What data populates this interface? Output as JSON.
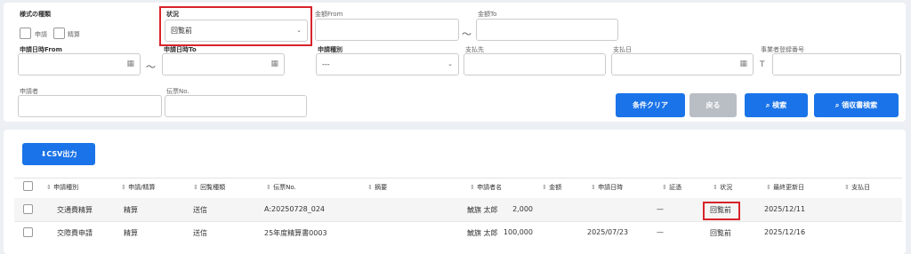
{
  "filter": {
    "form_type_label": "様式の種類",
    "checkbox_application": "申請",
    "checkbox_settlement": "精算",
    "status_label": "状況",
    "status_value": "回覧前",
    "amount_from_label": "金額From",
    "amount_to_label": "金額To",
    "tilde": "～",
    "date_from_label": "申請日時From",
    "date_to_label": "申請日時To",
    "app_type_label": "申請種別",
    "app_type_value": "---",
    "payee_label": "支払先",
    "pay_date_label": "支払日",
    "reg_no_label": "事業者登録番号",
    "reg_no_prefix": "T",
    "applicant_label": "申請者",
    "voucher_label": "伝票No.",
    "clear_button": "条件クリア",
    "back_button": "戻る",
    "search_button": "検索",
    "receipt_search_button": "領収書検索"
  },
  "results": {
    "csv_button": "CSV出力",
    "headers": [
      "申請種別",
      "申請/精算",
      "回覧種類",
      "伝票No.",
      "摘要",
      "申請者名",
      "金額",
      "申請日時",
      "証憑",
      "状況",
      "最終更新日",
      "支払日"
    ],
    "rows": [
      {
        "type": "交通費精算",
        "kind": "精算",
        "circ": "送信",
        "voucher": "A:20250728_024",
        "summary": "",
        "name": "鯱旗 太郎",
        "amount": "2,000",
        "date": "",
        "evidence": "—",
        "status": "回覧前",
        "updated": "2025/12/11",
        "paid": ""
      },
      {
        "type": "交際費申請",
        "kind": "精算",
        "circ": "送信",
        "voucher": "25年度精算書0003",
        "summary": "",
        "name": "鯱旗 太郎",
        "amount": "100,000",
        "date": "2025/07/23",
        "evidence": "—",
        "status": "回覧前",
        "updated": "2025/12/16",
        "paid": ""
      }
    ]
  },
  "colors": {
    "primary": "#1a73e8",
    "disabled": "#b9bec5",
    "highlight": "#d9232b"
  }
}
